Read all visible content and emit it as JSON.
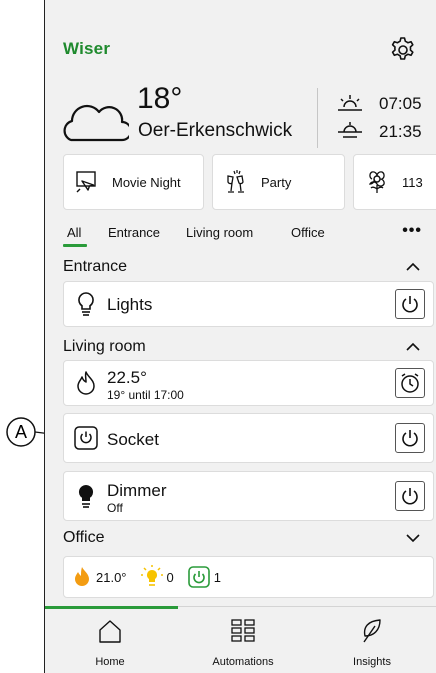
{
  "callout": {
    "letter": "A"
  },
  "header": {
    "logo": "Wiser"
  },
  "weather": {
    "temperature": "18°",
    "city": "Oer-Erkenschwick",
    "sunrise": "07:05",
    "sunset": "21:35"
  },
  "scenes": [
    {
      "label": "Movie Night",
      "icon": "movie-scene-icon"
    },
    {
      "label": "Party",
      "icon": "party-glasses-icon"
    },
    {
      "label": "113",
      "icon": "flower-icon"
    }
  ],
  "tabs": [
    "All",
    "Entrance",
    "Living room",
    "Office"
  ],
  "more": "•••",
  "sections": {
    "entrance": "Entrance",
    "living_room": "Living room",
    "office": "Office"
  },
  "devices": {
    "lights": {
      "title": "Lights",
      "icon": "lightbulb-outline-icon"
    },
    "heating": {
      "title": "22.5°",
      "sub": "19° until 17:00",
      "icon": "flame-outline-icon"
    },
    "socket": {
      "title": "Socket",
      "icon": "power-icon"
    },
    "dimmer": {
      "title": "Dimmer",
      "sub": "Off",
      "icon": "lightbulb-filled-icon"
    }
  },
  "office_summary": {
    "temperature": "21.0°",
    "lights_on": "0",
    "sockets_on": "1"
  },
  "nav": [
    {
      "label": "Home",
      "icon": "home-icon"
    },
    {
      "label": "Automations",
      "icon": "grid-icon"
    },
    {
      "label": "Insights",
      "icon": "leaf-icon"
    }
  ],
  "colors": {
    "accent": "#2a9b3a",
    "flame": "#f39c12",
    "bulb": "#f7c300"
  }
}
